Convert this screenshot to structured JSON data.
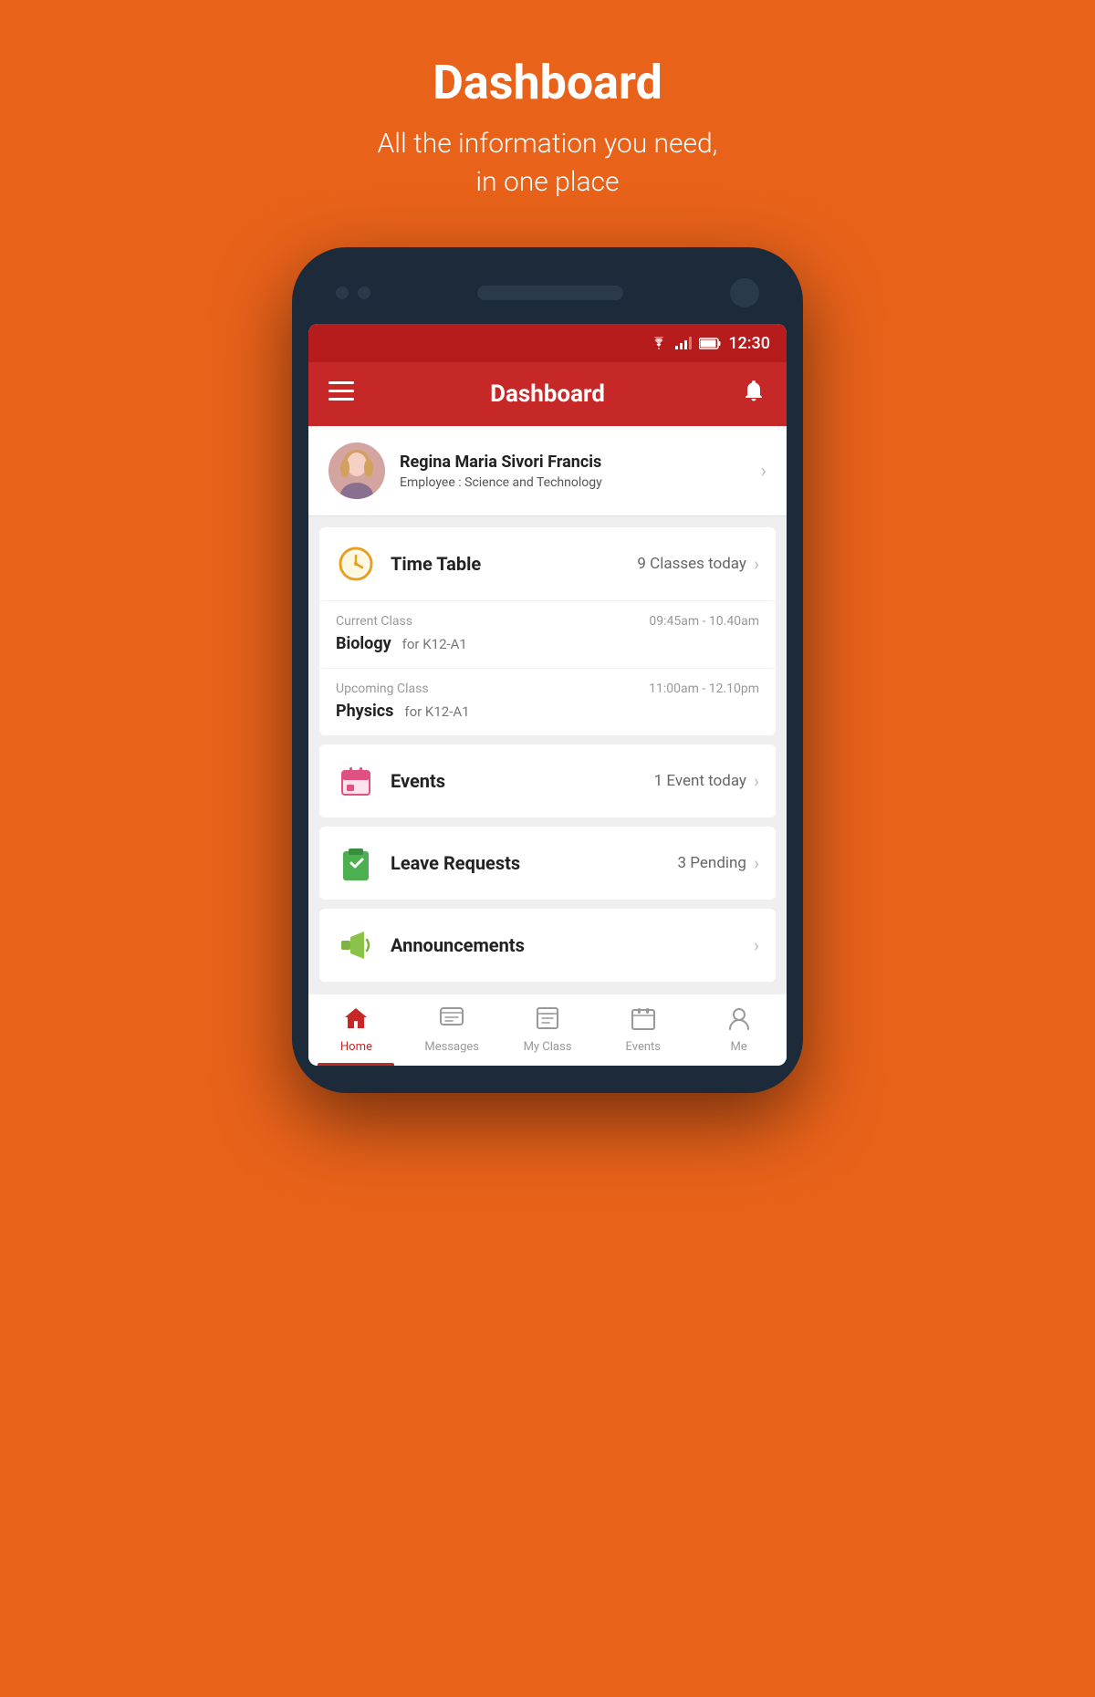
{
  "page": {
    "title": "Dashboard",
    "subtitle_line1": "All the information you need,",
    "subtitle_line2": "in one place"
  },
  "status_bar": {
    "time": "12:30"
  },
  "app_bar": {
    "title": "Dashboard"
  },
  "profile": {
    "name": "Regina Maria Sivori Francis",
    "role_label": "Employee :",
    "role_value": "Science and Technology"
  },
  "timetable": {
    "card_title": "Time Table",
    "count": "9 Classes today",
    "current_class": {
      "label": "Current Class",
      "time": "09:45am - 10.40am",
      "subject": "Biology",
      "group": "for K12-A1"
    },
    "upcoming_class": {
      "label": "Upcoming Class",
      "time": "11:00am - 12.10pm",
      "subject": "Physics",
      "group": "for K12-A1"
    }
  },
  "events": {
    "card_title": "Events",
    "count": "1 Event today"
  },
  "leave_requests": {
    "card_title": "Leave Requests",
    "count": "3 Pending"
  },
  "announcements": {
    "card_title": "Announcements"
  },
  "bottom_nav": {
    "items": [
      {
        "id": "home",
        "label": "Home",
        "active": true
      },
      {
        "id": "messages",
        "label": "Messages",
        "active": false
      },
      {
        "id": "myclass",
        "label": "My Class",
        "active": false
      },
      {
        "id": "events",
        "label": "Events",
        "active": false
      },
      {
        "id": "me",
        "label": "Me",
        "active": false
      }
    ]
  }
}
